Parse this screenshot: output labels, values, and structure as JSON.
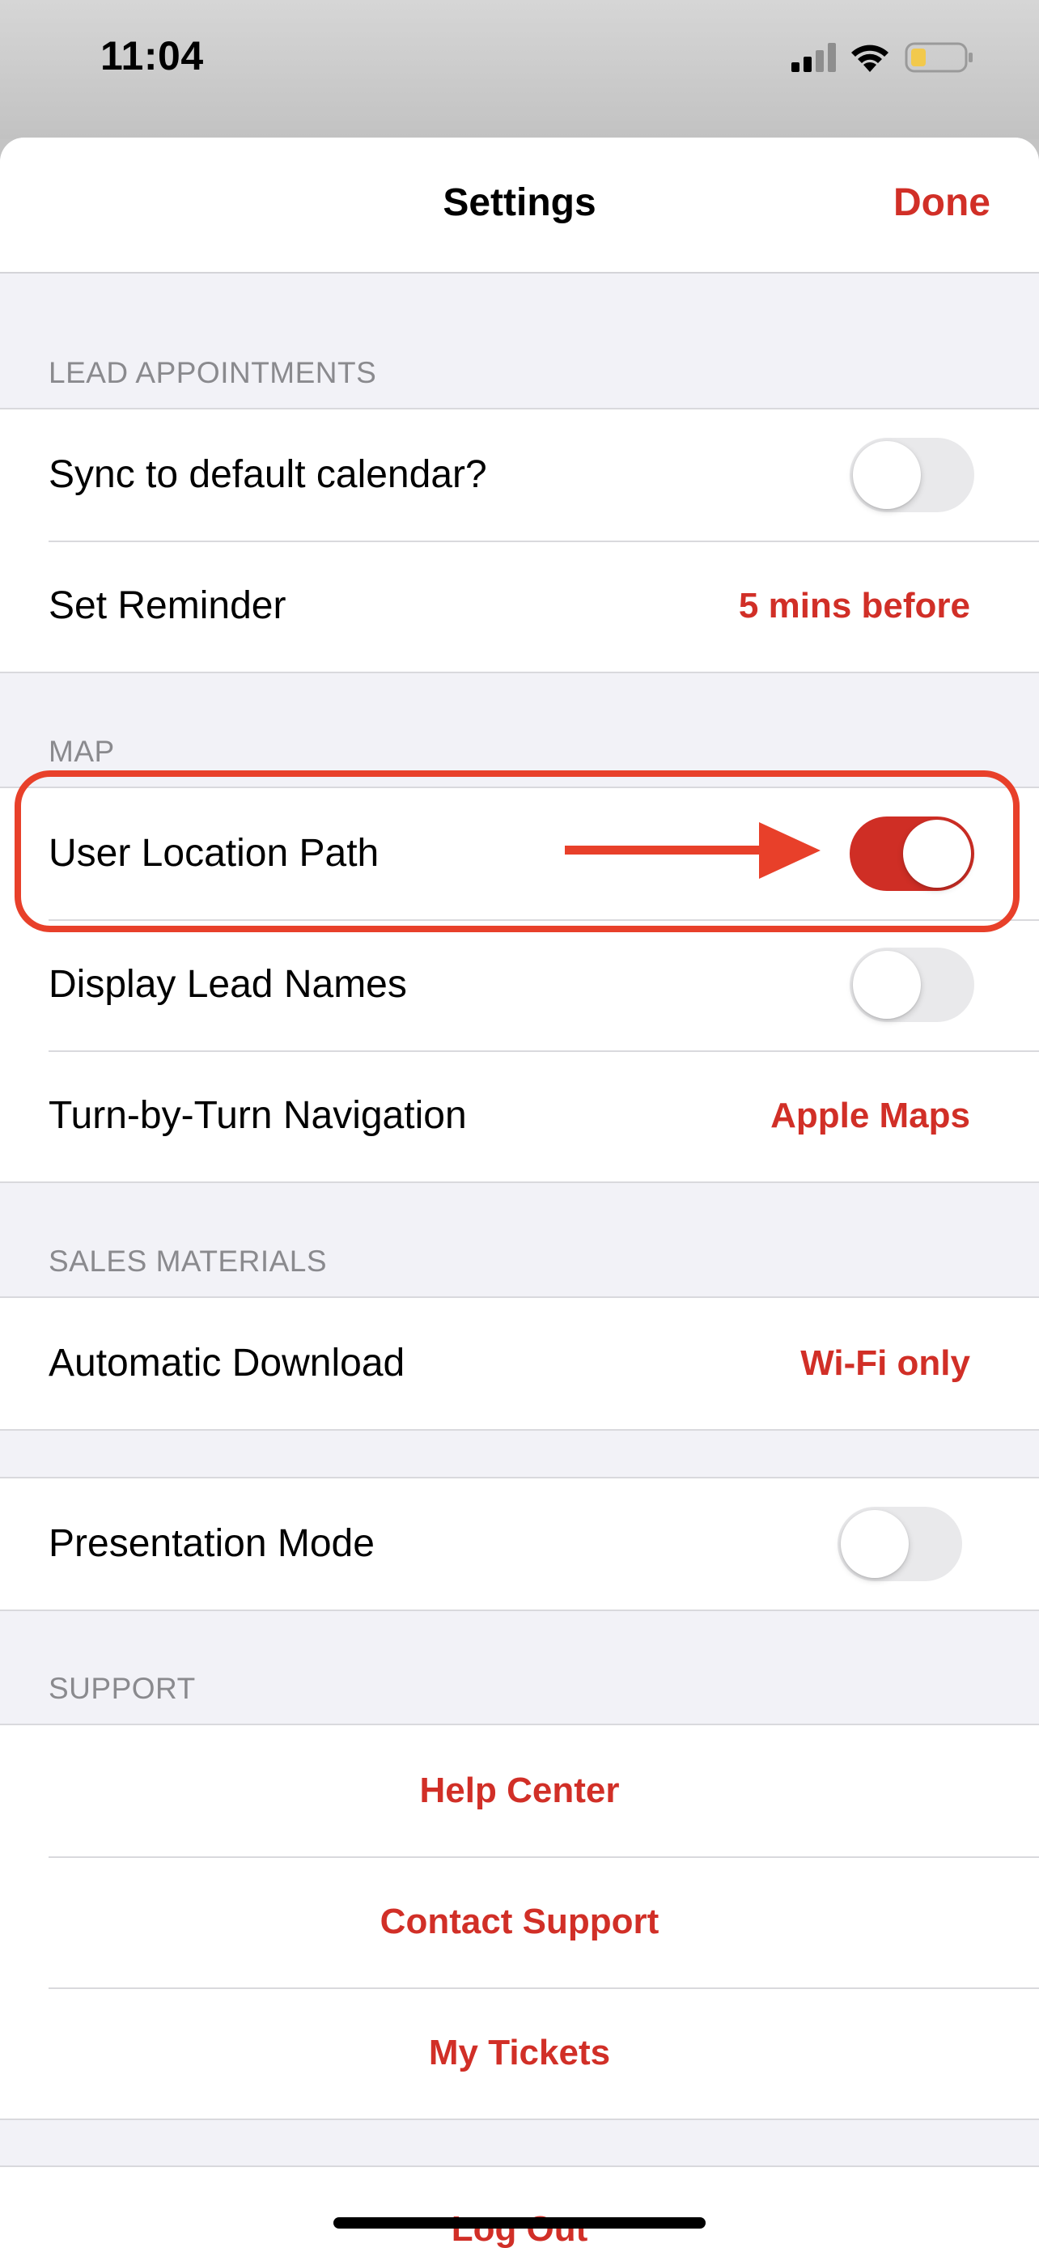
{
  "status_bar": {
    "time": "11:04",
    "icons": [
      "cellular-signal-icon",
      "wifi-icon",
      "battery-low-icon"
    ]
  },
  "nav": {
    "title": "Settings",
    "done_label": "Done"
  },
  "sections": {
    "lead_appointments": {
      "header": "LEAD APPOINTMENTS",
      "sync_calendar": {
        "label": "Sync to default calendar?",
        "enabled": false
      },
      "set_reminder": {
        "label": "Set Reminder",
        "value": "5 mins before"
      }
    },
    "map": {
      "header": "MAP",
      "user_location_path": {
        "label": "User Location Path",
        "enabled": true
      },
      "display_lead_names": {
        "label": "Display Lead Names",
        "enabled": false
      },
      "navigation": {
        "label": "Turn-by-Turn Navigation",
        "value": "Apple Maps"
      }
    },
    "sales_materials": {
      "header": "SALES MATERIALS",
      "automatic_download": {
        "label": "Automatic Download",
        "value": "Wi-Fi only"
      }
    },
    "presentation": {
      "presentation_mode": {
        "label": "Presentation Mode",
        "enabled": false
      }
    },
    "support": {
      "header": "SUPPORT",
      "help_center": "Help Center",
      "contact_support": "Contact Support",
      "my_tickets": "My Tickets"
    },
    "account": {
      "log_out": "Log Out"
    }
  },
  "colors": {
    "accent": "#d12f27",
    "annotation": "#e8402a",
    "toggle_off": "#e9e9eb",
    "background": "#f2f2f7"
  }
}
